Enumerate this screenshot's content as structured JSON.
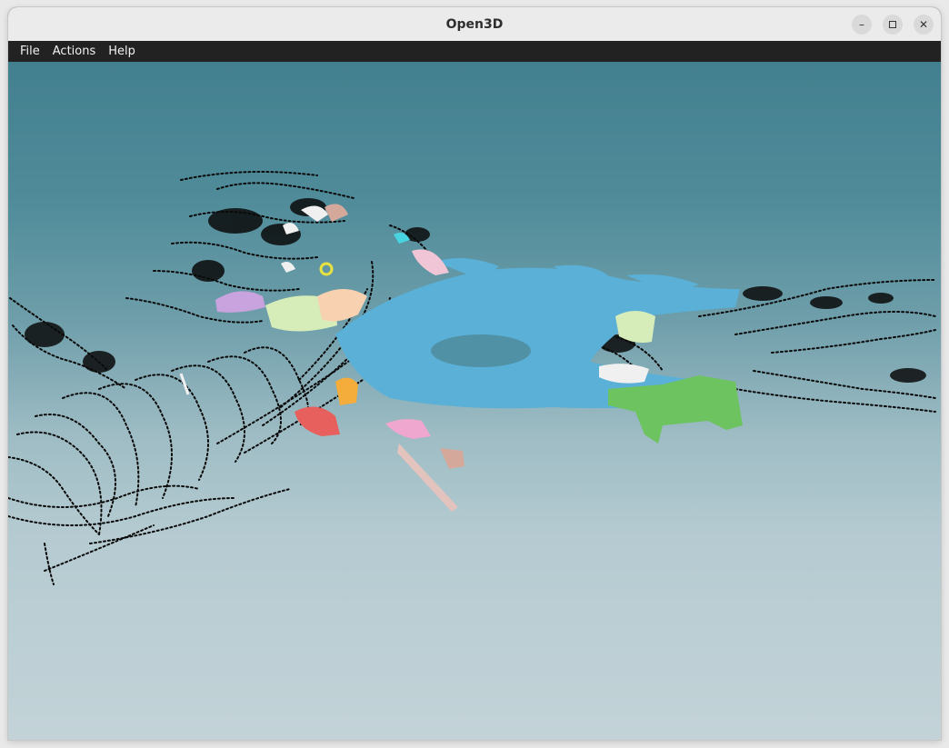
{
  "window": {
    "title": "Open3D",
    "controls": {
      "minimize_icon": "minimize-icon",
      "maximize_icon": "maximize-icon",
      "close_icon": "close-icon"
    }
  },
  "menubar": {
    "items": [
      {
        "label": "File"
      },
      {
        "label": "Actions"
      },
      {
        "label": "Help"
      }
    ]
  },
  "viewport": {
    "content": "point-cloud",
    "background_top": "#43808f",
    "background_bottom": "#c3d3d8",
    "segment_colors": {
      "ground": "#5ab0d6",
      "vegetation": "#6dc35f",
      "pink": "#f0a7cf",
      "red": "#e8605d",
      "orange": "#f4ad3a",
      "lilac": "#c9a3de",
      "pale_green": "#d6ecb9",
      "peach": "#f8d2b0",
      "salmon": "#d4a89b",
      "cyan": "#47d3e0",
      "yellow": "#e7e23f",
      "white": "#f0f0f0",
      "points": "#0a0a0a"
    }
  }
}
